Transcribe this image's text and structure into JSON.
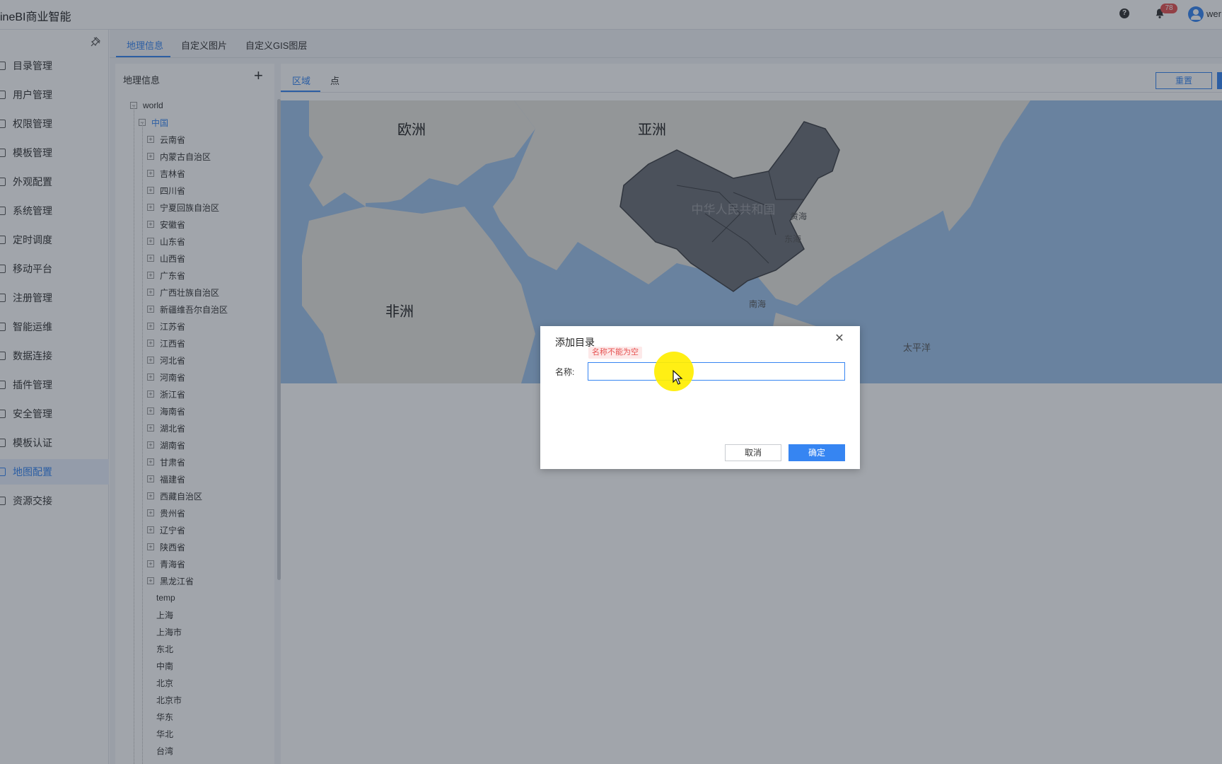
{
  "app": {
    "title": "ineBI商业智能",
    "notification_count": "78",
    "user_name": "wer"
  },
  "sidebar": {
    "items": [
      {
        "label": "目录管理"
      },
      {
        "label": "用户管理"
      },
      {
        "label": "权限管理"
      },
      {
        "label": "模板管理"
      },
      {
        "label": "外观配置"
      },
      {
        "label": "系统管理"
      },
      {
        "label": "定时调度"
      },
      {
        "label": "移动平台"
      },
      {
        "label": "注册管理"
      },
      {
        "label": "智能运维"
      },
      {
        "label": "数据连接"
      },
      {
        "label": "插件管理"
      },
      {
        "label": "安全管理"
      },
      {
        "label": "模板认证"
      },
      {
        "label": "地图配置",
        "active": true
      },
      {
        "label": "资源交接"
      }
    ]
  },
  "tabs": [
    {
      "label": "地理信息",
      "active": true
    },
    {
      "label": "自定义图片"
    },
    {
      "label": "自定义GIS图层"
    }
  ],
  "tree": {
    "header": "地理信息",
    "add_symbol": "+",
    "root": "world",
    "country": "中国",
    "provinces": [
      "云南省",
      "内蒙古自治区",
      "吉林省",
      "四川省",
      "宁夏回族自治区",
      "安徽省",
      "山东省",
      "山西省",
      "广东省",
      "广西壮族自治区",
      "新疆维吾尔自治区",
      "江苏省",
      "江西省",
      "河北省",
      "河南省",
      "浙江省",
      "海南省",
      "湖北省",
      "湖南省",
      "甘肃省",
      "福建省",
      "西藏自治区",
      "贵州省",
      "辽宁省",
      "陕西省",
      "青海省",
      "黑龙江省"
    ],
    "leaves": [
      "temp",
      "上海",
      "上海市",
      "东北",
      "中南",
      "北京",
      "北京市",
      "华东",
      "华北",
      "台湾"
    ]
  },
  "panel": {
    "subtabs": [
      {
        "label": "区域",
        "active": true
      },
      {
        "label": "点"
      }
    ],
    "reset_label": "重置"
  },
  "map": {
    "labels": {
      "europe": "欧洲",
      "asia": "亚洲",
      "africa": "非洲",
      "china": "中华人民共和国",
      "yellow_sea": "黄海",
      "east_sea": "东海",
      "south_sea": "南海",
      "pacific": "太平洋"
    },
    "colors": {
      "ocean": "#9fc3ea",
      "land": "#e7e5df",
      "highlight": "#6b6e75"
    }
  },
  "dialog": {
    "title": "添加目录",
    "name_label": "名称:",
    "error": "名称不能为空",
    "input_value": "",
    "cancel_label": "取消",
    "ok_label": "确定"
  },
  "icons": {
    "help": "?",
    "close": "✕",
    "collapse": "−",
    "expand": "+"
  },
  "colors": {
    "accent": "#3685f2",
    "error": "#e65251"
  }
}
